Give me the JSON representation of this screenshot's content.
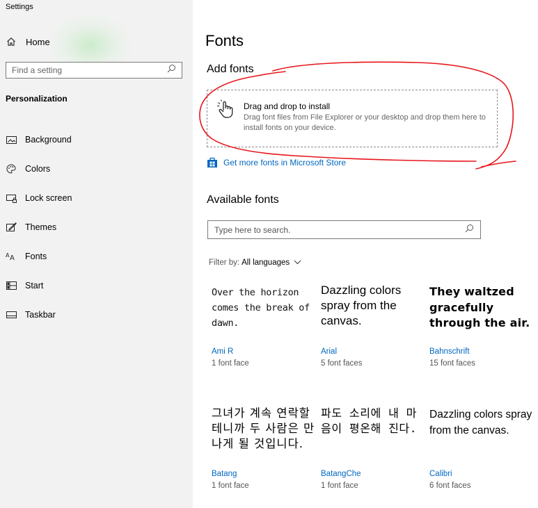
{
  "window": {
    "title": "Settings"
  },
  "sidebar": {
    "home_label": "Home",
    "search_placeholder": "Find a setting",
    "section_title": "Personalization",
    "items": [
      {
        "label": "Background",
        "icon": "background-icon"
      },
      {
        "label": "Colors",
        "icon": "palette-icon"
      },
      {
        "label": "Lock screen",
        "icon": "lock-screen-icon"
      },
      {
        "label": "Themes",
        "icon": "themes-icon"
      },
      {
        "label": "Fonts",
        "icon": "fonts-icon"
      },
      {
        "label": "Start",
        "icon": "start-icon"
      },
      {
        "label": "Taskbar",
        "icon": "taskbar-icon"
      }
    ]
  },
  "main": {
    "page_title": "Fonts",
    "add_fonts": {
      "title": "Add fonts",
      "drop_title": "Drag and drop to install",
      "drop_description": "Drag font files from File Explorer or your desktop and drop them here to install fonts on your device.",
      "store_link": "Get more fonts in Microsoft Store"
    },
    "available": {
      "title": "Available fonts",
      "search_placeholder": "Type here to search.",
      "filter_label": "Filter by:",
      "filter_value": "All languages"
    },
    "fonts": [
      {
        "preview": "Over the horizon comes the break of dawn.",
        "name": "Ami R",
        "faces": "1 font face"
      },
      {
        "preview": "Dazzling colors spray from the canvas.",
        "name": "Arial",
        "faces": "5 font faces"
      },
      {
        "preview": "They waltzed gracefully through the air.",
        "name": "Bahnschrift",
        "faces": "15 font faces"
      },
      {
        "preview": "그녀가 계속 연락할 테니까 두 사람은 만나게 될 것입니다.",
        "name": "Batang",
        "faces": "1 font face"
      },
      {
        "preview": "파도 소리에 내 마음이 평온해 진다.",
        "name": "BatangChe",
        "faces": "1 font face"
      },
      {
        "preview": "Dazzling colors spray from the canvas.",
        "name": "Calibri",
        "faces": "6 font faces"
      }
    ]
  },
  "colors": {
    "accent": "#0067c0",
    "sidebar_bg": "#f2f2f2",
    "annotation_red": "#e8141a"
  }
}
